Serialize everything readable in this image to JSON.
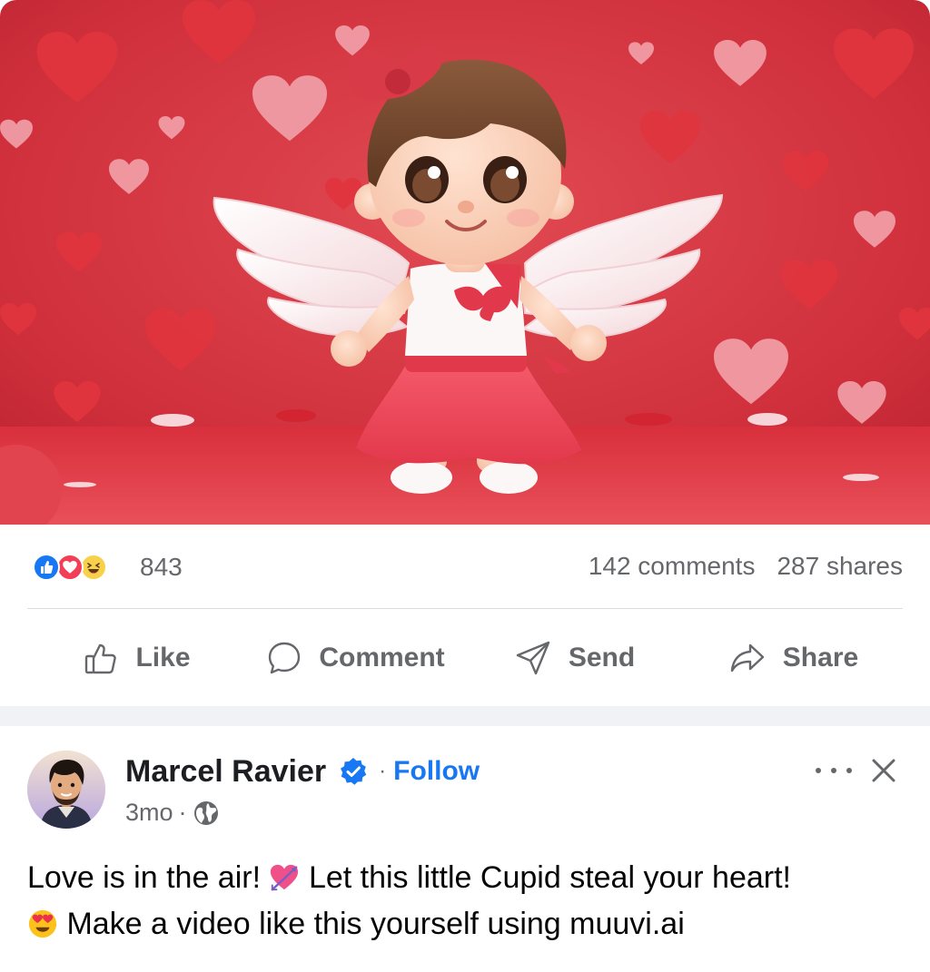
{
  "stats": {
    "reaction_icons": [
      "like-reaction-icon",
      "love-reaction-icon",
      "haha-reaction-icon"
    ],
    "reaction_count": "843",
    "comments": "142 comments",
    "shares": "287 shares"
  },
  "actions": {
    "like": "Like",
    "comment": "Comment",
    "send": "Send",
    "share": "Share"
  },
  "post": {
    "author": "Marcel Ravier",
    "follow": "Follow",
    "separator": "·",
    "age": "3mo",
    "caption_part1": "Love is in the air!",
    "caption_part2": "Let this little Cupid steal your heart!",
    "caption_part3": "Make a video like this yourself using muuvi.ai"
  },
  "colors": {
    "accent": "#1877f2",
    "secondary_text": "#65676b",
    "divider": "#dadde1",
    "band": "#f0f2f5",
    "like": "#1877f2",
    "love": "#f33e58",
    "haha": "#f7d14b"
  }
}
